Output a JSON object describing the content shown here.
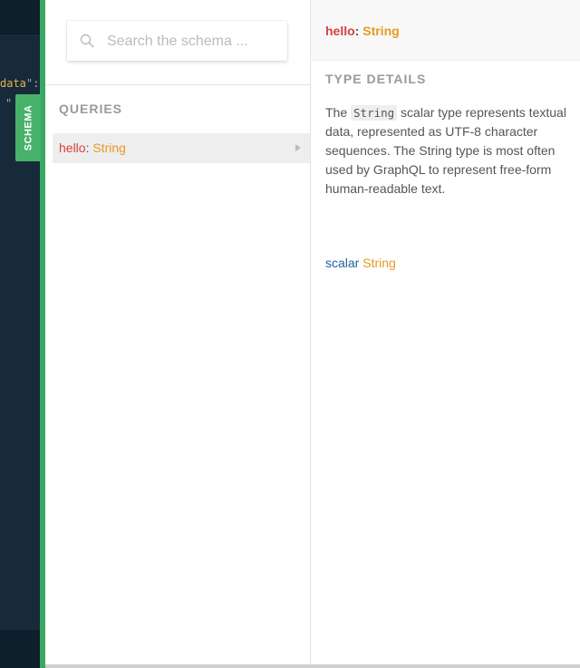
{
  "editor": {
    "code_line_1_key": "data",
    "code_line_1_punct": "\":",
    "code_line_2": "\""
  },
  "schema_tab": {
    "label": "SCHEMA"
  },
  "explorer": {
    "search": {
      "placeholder": "Search the schema ...",
      "value": ""
    },
    "queries_title": "QUERIES",
    "query": {
      "name": "hello",
      "colon": ":",
      "type": "String"
    }
  },
  "details": {
    "header": {
      "name": "hello",
      "colon": ":",
      "type": "String"
    },
    "section_title": "TYPE DETAILS",
    "description_prefix": "The ",
    "description_code": "String",
    "description_suffix": " scalar type represents textual data, represented as UTF-8 character sequences. The String type is most often used by GraphQL to represent free-form human-readable text.",
    "scalar_keyword": "scalar",
    "scalar_type": "String"
  },
  "colors": {
    "accent_green": "#48b26b",
    "field_red": "#d64142",
    "type_orange": "#e49a23",
    "keyword_blue": "#1f61a0"
  }
}
